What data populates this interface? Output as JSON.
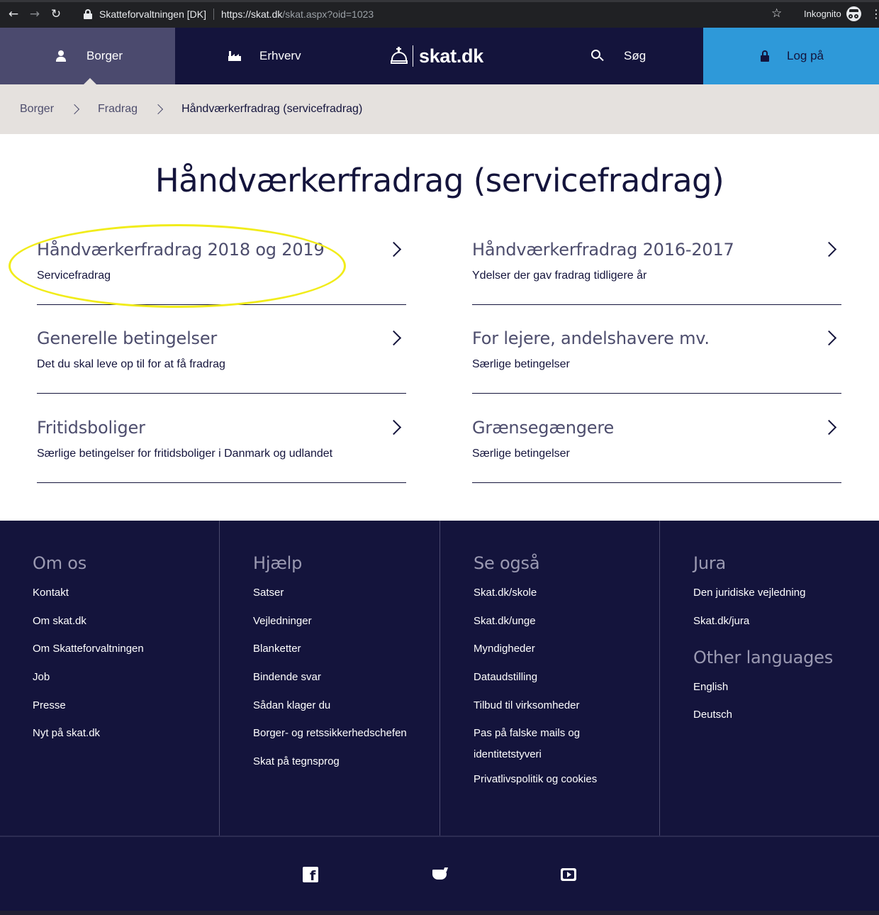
{
  "browser": {
    "site_name": "Skatteforvaltningen [DK]",
    "url_host": "https://skat.dk",
    "url_path": "/skat.aspx?oid=1023",
    "incognito_label": "Inkognito"
  },
  "header": {
    "borger": "Borger",
    "erhverv": "Erhverv",
    "logo": "skat.dk",
    "search": "Søg",
    "login": "Log på"
  },
  "breadcrumb": [
    "Borger",
    "Fradrag",
    "Håndværkerfradrag (servicefradrag)"
  ],
  "page": {
    "title": "Håndværkerfradrag (servicefradrag)",
    "cards": [
      {
        "title": "Håndværkerfradrag 2018 og 2019",
        "subtitle": "Servicefradrag"
      },
      {
        "title": "Håndværkerfradrag 2016-2017",
        "subtitle": "Ydelser der gav fradrag tidligere år"
      },
      {
        "title": "Generelle betingelser",
        "subtitle": "Det du skal leve op til for at få fradrag"
      },
      {
        "title": "For lejere, andelshavere mv.",
        "subtitle": "Særlige betingelser"
      },
      {
        "title": "Fritidsboliger",
        "subtitle": "Særlige betingelser for fritidsboliger i Danmark og udlandet"
      },
      {
        "title": "Grænsegængere",
        "subtitle": "Særlige betingelser"
      }
    ]
  },
  "footer": {
    "om_os": {
      "heading": "Om os",
      "links": [
        "Kontakt",
        "Om skat.dk",
        "Om Skatteforvaltningen",
        "Job",
        "Presse",
        "Nyt på skat.dk"
      ]
    },
    "hjaelp": {
      "heading": "Hjælp",
      "links": [
        "Satser",
        "Vejledninger",
        "Blanketter",
        "Bindende svar",
        "Sådan klager du",
        "Borger- og retssikkerhedschefen",
        "Skat på tegnsprog"
      ]
    },
    "se_ogsaa": {
      "heading": "Se også",
      "links": [
        "Skat.dk/skole",
        "Skat.dk/unge",
        "Myndigheder",
        "Dataudstilling",
        "Tilbud til virksomheder",
        "Pas på falske mails og identitetstyveri",
        "Privatlivspolitik og cookies"
      ]
    },
    "jura": {
      "heading": "Jura",
      "links": [
        "Den juridiske vejledning",
        "Skat.dk/jura"
      ]
    },
    "other_languages": {
      "heading": "Other languages",
      "links": [
        "English",
        "Deutsch"
      ]
    },
    "social": [
      "facebook-icon",
      "twitter-icon",
      "youtube-icon"
    ]
  },
  "colors": {
    "navy": "#14143c",
    "active_tab": "#4b4a6e",
    "login_blue": "#2e99d9",
    "breadcrumb_bg": "#e5e1de",
    "highlight": "#f1ec1a"
  }
}
